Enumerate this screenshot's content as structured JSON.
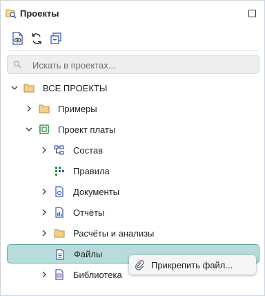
{
  "panel": {
    "title": "Проекты"
  },
  "search": {
    "placeholder": "Искать в проектах..."
  },
  "tree": {
    "items": [
      {
        "label": "ВСЕ ПРОЕКТЫ",
        "expanded": true
      },
      {
        "label": "Примеры",
        "expanded": false
      },
      {
        "label": "Проект платы",
        "expanded": true
      },
      {
        "label": "Состав",
        "expanded": false
      },
      {
        "label": "Правила"
      },
      {
        "label": "Документы",
        "expanded": false
      },
      {
        "label": "Отчёты",
        "expanded": false
      },
      {
        "label": "Расчёты и анализы",
        "expanded": false
      },
      {
        "label": "Файлы",
        "selected": true
      },
      {
        "label": "Библиотека",
        "expanded": false
      }
    ]
  },
  "context_menu": {
    "items": [
      {
        "label": "Прикрепить файл..."
      }
    ]
  },
  "colors": {
    "selection_bg": "#b6dcdc",
    "selection_border": "#6aa7a7",
    "folder": "#f3d08a",
    "accent_blue": "#3b5bb5",
    "accent_green": "#1f8a3a"
  }
}
